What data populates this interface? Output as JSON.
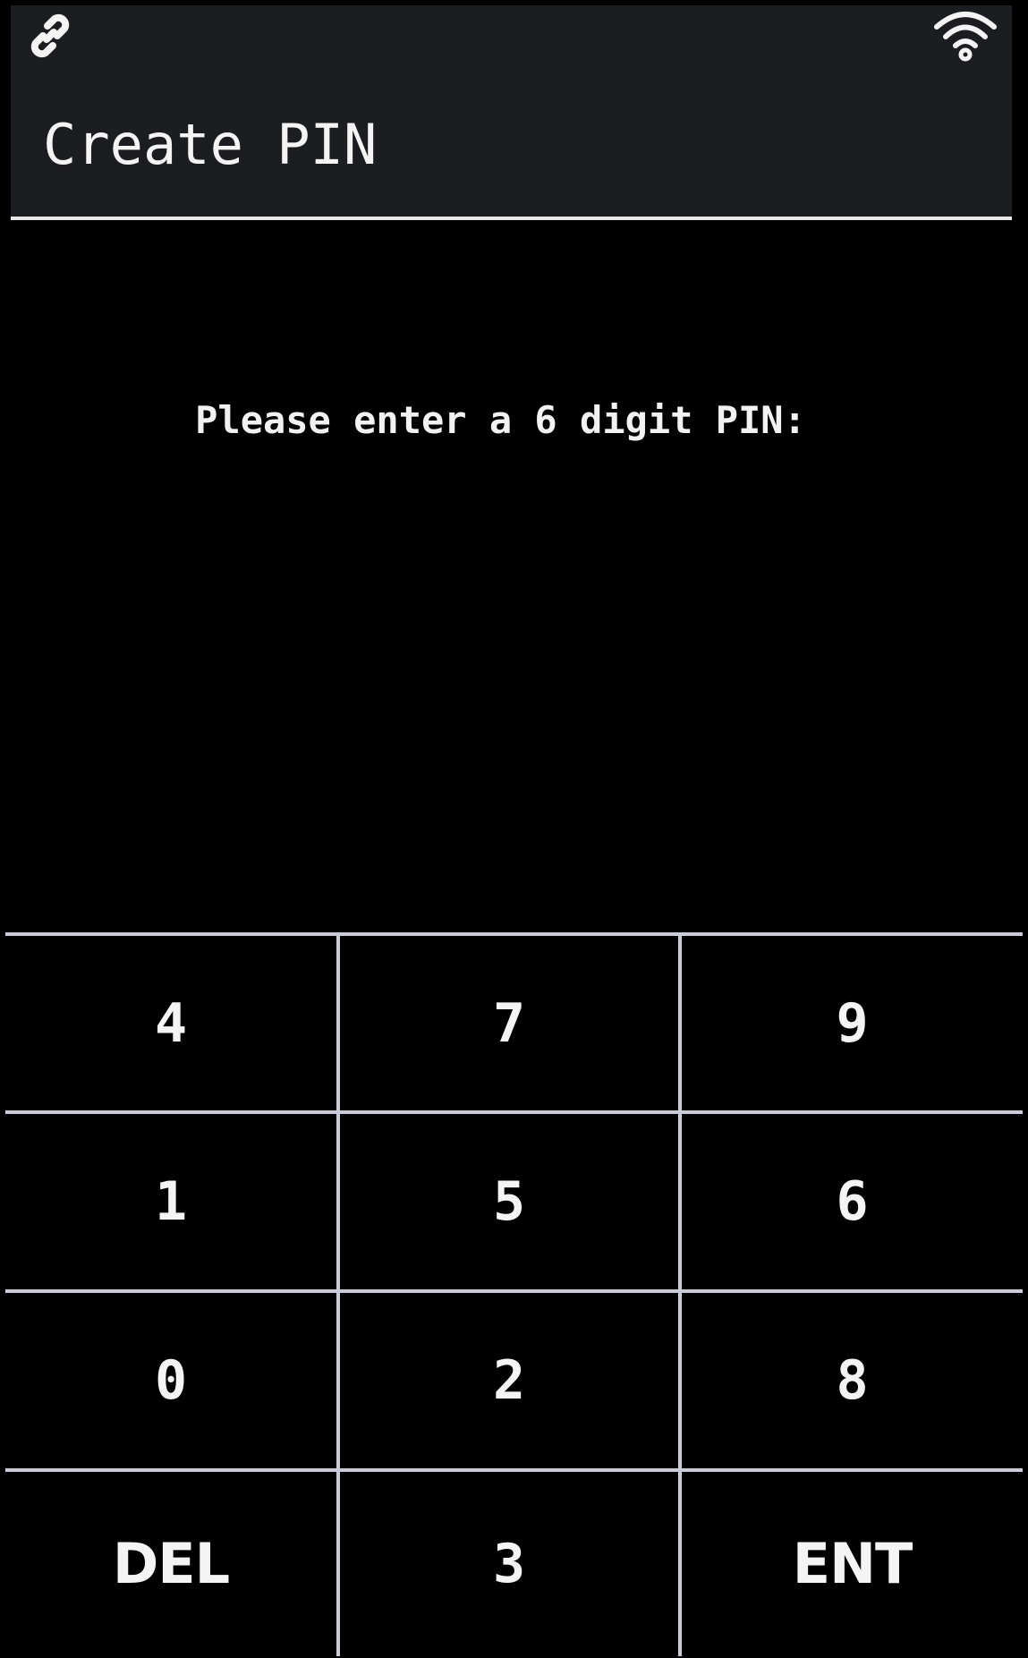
{
  "status_bar": {
    "left_icon": "link-icon",
    "right_icon": "wifi-icon"
  },
  "header": {
    "title": "Create PIN"
  },
  "main": {
    "prompt": "Please enter a 6 digit PIN:"
  },
  "keypad": {
    "keys": [
      {
        "label": "4"
      },
      {
        "label": "7"
      },
      {
        "label": "9"
      },
      {
        "label": "1"
      },
      {
        "label": "5"
      },
      {
        "label": "6"
      },
      {
        "label": "0"
      },
      {
        "label": "2"
      },
      {
        "label": "8"
      },
      {
        "label": "DEL"
      },
      {
        "label": "3"
      },
      {
        "label": "ENT"
      }
    ]
  },
  "colors": {
    "background": "#000000",
    "header_background": "#1b1d20",
    "text": "#f2f2f2",
    "grid_lines": "#c9ccd6"
  }
}
